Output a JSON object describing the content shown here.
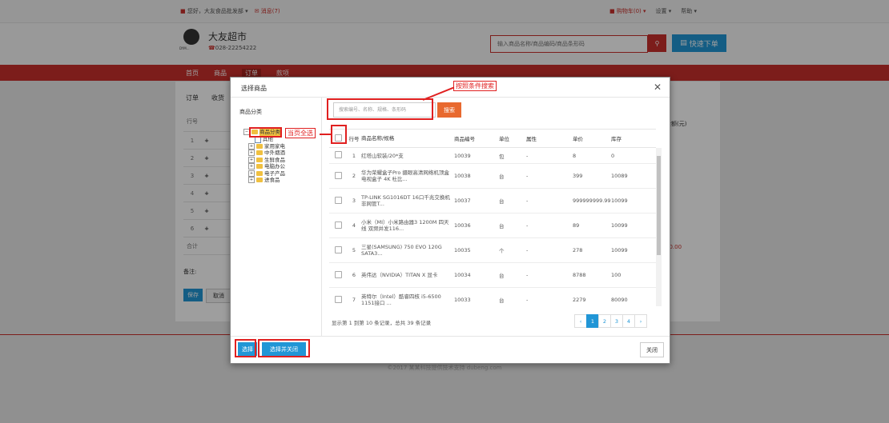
{
  "topbar": {
    "greeting": "您好，大友食品批发部 ▾",
    "messages": "消息(7)",
    "cart": "购物车(0) ▾",
    "settings": "设置 ▾",
    "help": "帮助 ▾"
  },
  "header": {
    "store_name": "大友超市",
    "phone": "028-22254222",
    "logo_tag": "DYM...",
    "search_placeholder": "输入商品名称/商品编码/商品条形码",
    "quick_order": "快速下单"
  },
  "nav": [
    "首页",
    "商品",
    "订单",
    "款项"
  ],
  "main": {
    "tabs": [
      "订单",
      "收货"
    ],
    "rows": [
      "1",
      "2",
      "3",
      "4",
      "5",
      "6"
    ],
    "total_label": "合计",
    "amount_header": "金额(元)",
    "total_amount": "¥0.00",
    "remark_label": "备注:",
    "save": "保存",
    "cancel": "取消"
  },
  "footer": "©2017 某某科技提供技术支持 dubeng.com",
  "modal": {
    "title": "选择商品",
    "category_label": "商品分类",
    "filter_placeholder": "搜索编号、名称、规格、条形码",
    "search_button": "搜索",
    "tree": {
      "root": "商品分类",
      "children": [
        "其他",
        "家用家电",
        "中外烟酒",
        "生鲜食品",
        "电脑办公",
        "电子产品",
        "进食品"
      ]
    },
    "columns": [
      "行号",
      "商品名称/规格",
      "商品编号",
      "单位",
      "属性",
      "单价",
      "库存"
    ],
    "rows": [
      {
        "idx": "1",
        "name": "红塔山软装/20*支",
        "code": "10039",
        "unit": "包",
        "attr": "-",
        "price": "8",
        "stock": "0"
      },
      {
        "idx": "2",
        "name": "华为荣耀盒子Pro 摄眼高清网络机顶盒 电视盒子 4K 杜比...",
        "code": "10038",
        "unit": "台",
        "attr": "-",
        "price": "399",
        "stock": "10089"
      },
      {
        "idx": "3",
        "name": "TP-LINK SG1016DT 16口千兆交换机 非网管T...",
        "code": "10037",
        "unit": "台",
        "attr": "-",
        "price": "999999999.99",
        "stock": "10099"
      },
      {
        "idx": "4",
        "name": "小米（MI）小米路由器3 1200M 四天线 双频并发116...",
        "code": "10036",
        "unit": "台",
        "attr": "-",
        "price": "89",
        "stock": "10099"
      },
      {
        "idx": "5",
        "name": "三星(SAMSUNG) 750 EVO 120G SATA3...",
        "code": "10035",
        "unit": "个",
        "attr": "-",
        "price": "278",
        "stock": "10099"
      },
      {
        "idx": "6",
        "name": "英伟达（NVIDIA）TITAN X 显卡",
        "code": "10034",
        "unit": "台",
        "attr": "-",
        "price": "8788",
        "stock": "100"
      },
      {
        "idx": "7",
        "name": "英特尔（Intel）酷睿四核 i5-6500 1151接口 ...",
        "code": "10033",
        "unit": "台",
        "attr": "-",
        "price": "2279",
        "stock": "80090"
      }
    ],
    "pager_info": "显示第 1 到第 10 条记录，总共 39 条记录",
    "pages": [
      "‹",
      "1",
      "2",
      "3",
      "4",
      "›"
    ],
    "select": "选择",
    "select_close": "选择并关闭",
    "close": "关闭"
  },
  "annotations": {
    "filter": "按照条件搜索",
    "select_all": "当页全选"
  },
  "colors": {
    "brand_red": "#c9302c",
    "primary_blue": "#2196d6",
    "search_orange": "#e8692f",
    "annotation_red": "#e02020"
  }
}
